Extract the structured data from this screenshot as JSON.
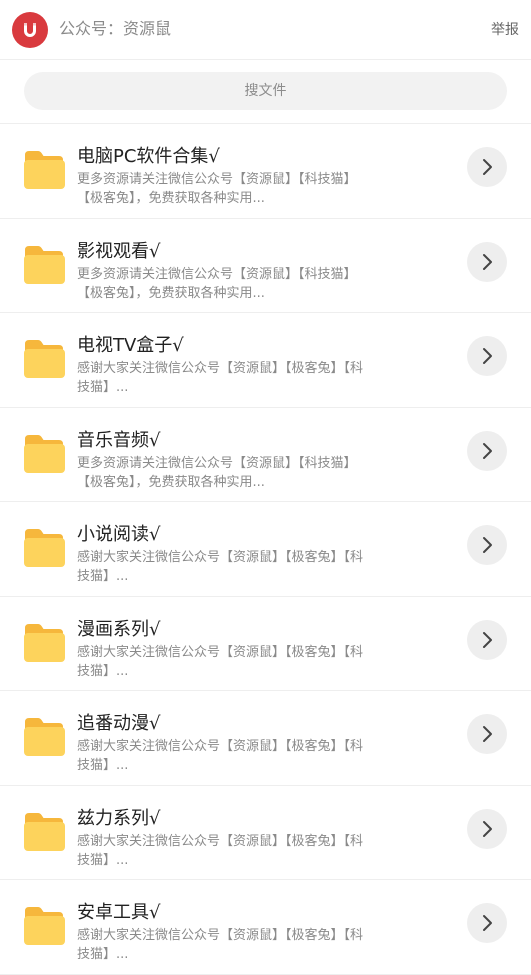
{
  "header": {
    "account_label": "公众号：资源鼠",
    "report_label": "举报",
    "avatar_icon": "magnet-icon",
    "avatar_color": "#d93a3e"
  },
  "search": {
    "placeholder": "搜文件",
    "value": ""
  },
  "accent": {
    "folder_color": "#fdd35c",
    "folder_tab_color": "#f6b73c"
  },
  "items": [
    {
      "title": "电脑PC软件合集√",
      "desc": "更多资源请关注微信公众号【资源鼠】【科技猫】【极客兔】，免费获取各种实用..."
    },
    {
      "title": "影视观看√",
      "desc": "更多资源请关注微信公众号【资源鼠】【科技猫】【极客兔】，免费获取各种实用..."
    },
    {
      "title": "电视TV盒子√",
      "desc": "感谢大家关注微信公众号【资源鼠】【极客兔】【科技猫】..."
    },
    {
      "title": "音乐音频√",
      "desc": "更多资源请关注微信公众号【资源鼠】【科技猫】【极客兔】，免费获取各种实用..."
    },
    {
      "title": "小说阅读√",
      "desc": "感谢大家关注微信公众号【资源鼠】【极客兔】【科技猫】..."
    },
    {
      "title": "漫画系列√",
      "desc": "感谢大家关注微信公众号【资源鼠】【极客兔】【科技猫】..."
    },
    {
      "title": "追番动漫√",
      "desc": "感谢大家关注微信公众号【资源鼠】【极客兔】【科技猫】..."
    },
    {
      "title": "兹力系列√",
      "desc": "感谢大家关注微信公众号【资源鼠】【极客兔】【科技猫】..."
    },
    {
      "title": "安卓工具√",
      "desc": "感谢大家关注微信公众号【资源鼠】【极客兔】【科技猫】..."
    }
  ]
}
